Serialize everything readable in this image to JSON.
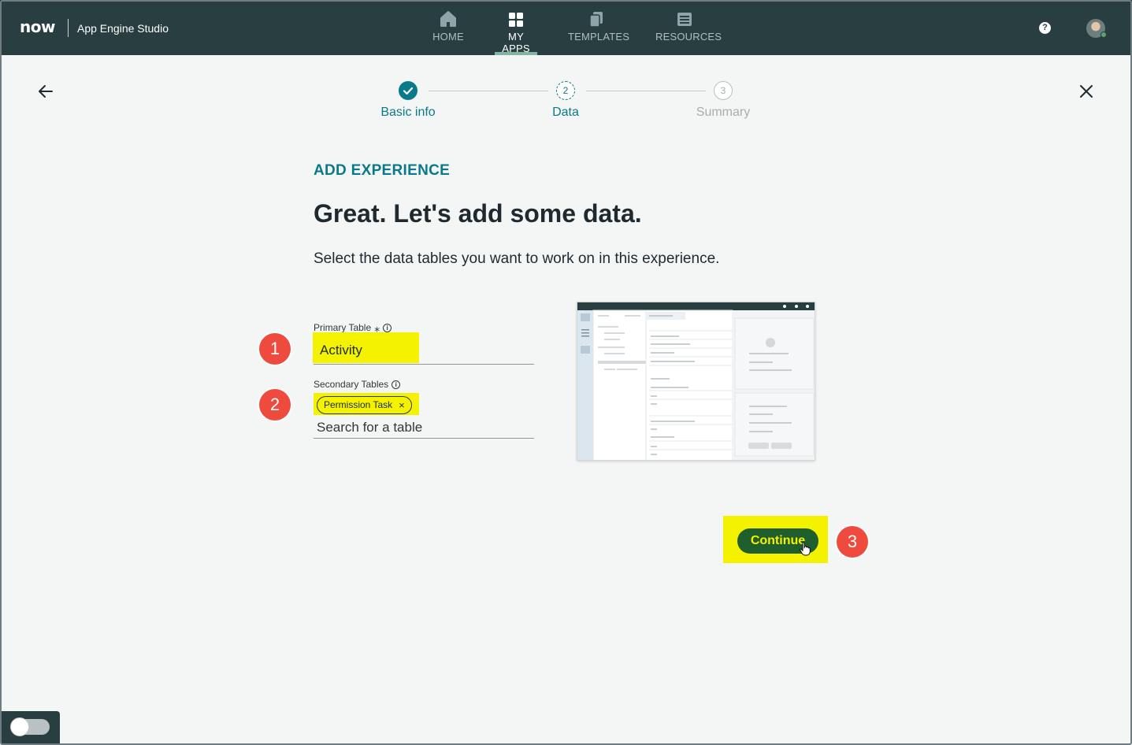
{
  "header": {
    "logo": "now",
    "app_name": "App Engine Studio",
    "nav": [
      {
        "label": "HOME",
        "icon": "home-icon",
        "active": false
      },
      {
        "label": "MY APPS",
        "icon": "grid-icon",
        "active": true
      },
      {
        "label": "TEMPLATES",
        "icon": "copy-icon",
        "active": false
      },
      {
        "label": "RESOURCES",
        "icon": "news-icon",
        "active": false
      }
    ],
    "help_glyph": "?"
  },
  "stepper": {
    "steps": [
      {
        "label": "Basic info",
        "number": "1",
        "state": "complete"
      },
      {
        "label": "Data",
        "number": "2",
        "state": "current"
      },
      {
        "label": "Summary",
        "number": "3",
        "state": "upcoming"
      }
    ]
  },
  "main": {
    "section_tag": "ADD EXPERIENCE",
    "title": "Great. Let's add some data.",
    "subtitle": "Select the data tables you want to work on in this experience.",
    "primary_table": {
      "label": "Primary Table",
      "required_mark": "⁎",
      "value": "Activity"
    },
    "secondary_tables": {
      "label": "Secondary Tables",
      "chips": [
        "Permission Task"
      ],
      "chip_remove": "×",
      "placeholder": "Search for a table"
    },
    "continue_label": "Continue"
  },
  "annotations": [
    "1",
    "2",
    "3"
  ],
  "colors": {
    "topbar": "#293e40",
    "accent_teal": "#0a7a8a",
    "highlight": "#f5f200",
    "badge": "#ee4a3e",
    "continue_bg": "#1f5f2e"
  }
}
